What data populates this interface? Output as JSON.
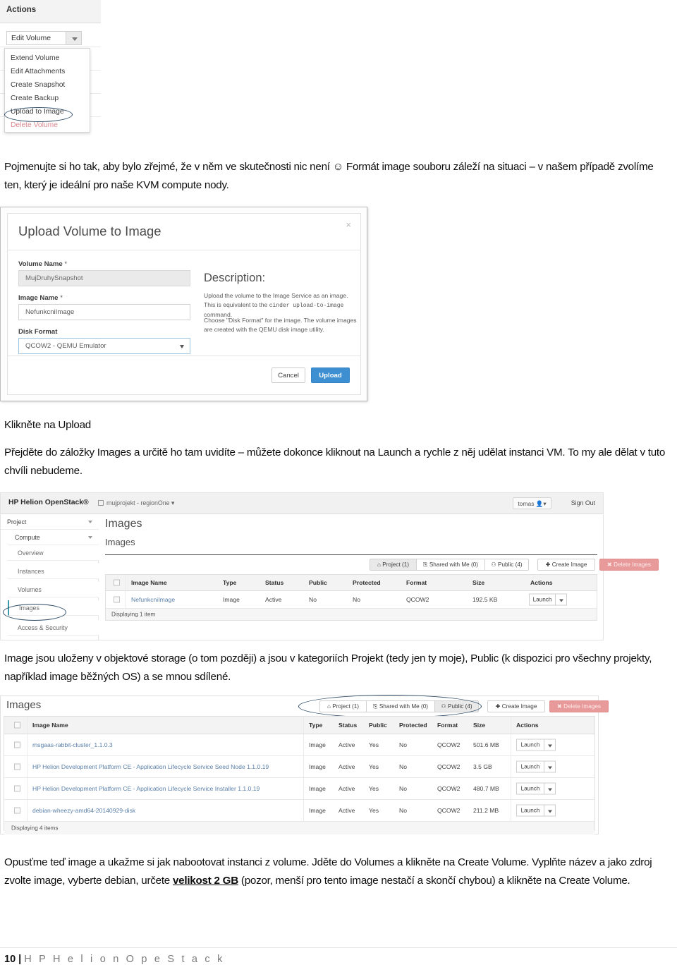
{
  "page": {
    "footer_page_number": "10",
    "footer_separator": "|",
    "footer_title": "H P   H e l i o n   O p e S t a c k"
  },
  "shot_actions": {
    "panel_title": "Actions",
    "edit_button": "Edit Volume",
    "menu_items": [
      "Extend Volume",
      "Edit Attachments",
      "Create Snapshot",
      "Create Backup",
      "Upload to Image",
      "Delete Volume"
    ],
    "highlighted_item": "Upload to Image"
  },
  "paragraph_1": "Pojmenujte si ho tak, aby bylo zřejmé, že v něm ve skutečnosti nic není ☺ Formát image souboru záleží na situaci – v našem případě zvolíme ten, který je ideální pro naše KVM compute nody.",
  "shot_upload": {
    "title": "Upload Volume to Image",
    "close_icon": "×",
    "volume_name_label": "Volume Name",
    "required_mark": "*",
    "volume_name_value": "MujDruhySnapshot",
    "image_name_label": "Image Name",
    "image_name_value": "NefunkcniImage",
    "disk_format_label": "Disk Format",
    "disk_format_value": "QCOW2 - QEMU Emulator",
    "description_heading": "Description:",
    "description_p1_a": "Upload the volume to the Image Service as an image. This is equivalent to the ",
    "description_p1_code": "cinder upload-to-image",
    "description_p1_b": " command.",
    "description_p2": "Choose \"Disk Format\" for the image. The volume images are created with the QEMU disk image utility.",
    "cancel_button": "Cancel",
    "upload_button": "Upload"
  },
  "paragraph_2": "Klikněte na Upload",
  "paragraph_3": "Přejděte do záložky Images a určitě ho tam uvidíte – můžete dokonce kliknout na Launch a rychle z něj udělat instanci VM. To my ale dělat v tuto chvíli nebudeme.",
  "shot_dashboard": {
    "brand": "HP Helion OpenStack®",
    "project_selector": "mujprojekt - regionOne",
    "user_menu": "tomas",
    "sign_out": "Sign Out",
    "sidebar": [
      {
        "label": "Project",
        "level": 0,
        "caret": true,
        "active": false
      },
      {
        "label": "Compute",
        "level": 1,
        "caret": true,
        "active": false
      },
      {
        "label": "Overview",
        "level": 2,
        "caret": false,
        "active": false
      },
      {
        "label": "Instances",
        "level": 2,
        "caret": false,
        "active": false
      },
      {
        "label": "Volumes",
        "level": 2,
        "caret": false,
        "active": false
      },
      {
        "label": "Images",
        "level": 2,
        "caret": false,
        "active": true
      },
      {
        "label": "Access & Security",
        "level": 2,
        "caret": false,
        "active": false
      }
    ],
    "page_heading": "Images",
    "section_heading": "Images",
    "filters": [
      {
        "label": "Project (1)",
        "icon": "home-icon",
        "active": true
      },
      {
        "label": "Shared with Me (0)",
        "icon": "share-icon",
        "active": false
      },
      {
        "label": "Public (4)",
        "icon": "group-icon",
        "active": false
      }
    ],
    "create_image_button": "Create Image",
    "delete_images_button": "Delete Images",
    "columns": [
      "Image Name",
      "Type",
      "Status",
      "Public",
      "Protected",
      "Format",
      "Size",
      "Actions"
    ],
    "rows": [
      {
        "name": "NefunkcniImage",
        "type": "Image",
        "status": "Active",
        "public": "No",
        "protected": "No",
        "format": "QCOW2",
        "size": "192.5 KB",
        "action": "Launch"
      }
    ],
    "displaying": "Displaying 1 item"
  },
  "paragraph_4": "Image jsou uloženy v objektové storage (o tom později) a jsou v kategoriích Projekt (tedy jen ty moje), Public (k dispozici pro všechny projekty, například image běžných OS) a se mnou sdílené.",
  "shot_public": {
    "section_heading": "Images",
    "filters": [
      {
        "label": "Project (1)",
        "icon": "home-icon",
        "active": false
      },
      {
        "label": "Shared with Me (0)",
        "icon": "share-icon",
        "active": false
      },
      {
        "label": "Public (4)",
        "icon": "group-icon",
        "active": true
      }
    ],
    "create_image_button": "Create Image",
    "delete_images_button": "Delete Images",
    "columns": [
      "Image Name",
      "Type",
      "Status",
      "Public",
      "Protected",
      "Format",
      "Size",
      "Actions"
    ],
    "rows": [
      {
        "name": "msgaas-rabbit-cluster_1.1.0.3",
        "type": "Image",
        "status": "Active",
        "public": "Yes",
        "protected": "No",
        "format": "QCOW2",
        "size": "501.6 MB",
        "action": "Launch"
      },
      {
        "name": "HP Helion Development Platform CE - Application Lifecycle Service Seed Node 1.1.0.19",
        "type": "Image",
        "status": "Active",
        "public": "Yes",
        "protected": "No",
        "format": "QCOW2",
        "size": "3.5 GB",
        "action": "Launch"
      },
      {
        "name": "HP Helion Development Platform CE - Application Lifecycle Service Installer 1.1.0.19",
        "type": "Image",
        "status": "Active",
        "public": "Yes",
        "protected": "No",
        "format": "QCOW2",
        "size": "480.7 MB",
        "action": "Launch"
      },
      {
        "name": "debian-wheezy-amd64-20140929-disk",
        "type": "Image",
        "status": "Active",
        "public": "Yes",
        "protected": "No",
        "format": "QCOW2",
        "size": "211.2 MB",
        "action": "Launch"
      }
    ],
    "displaying": "Displaying 4 items"
  },
  "paragraph_5_a": "Opusťme teď image a ukažme si jak nabootovat instanci z volume. Jděte do Volumes a klikněte na Create Volume. Vyplňte název a jako zdroj zvolte image, vyberte debian, určete ",
  "paragraph_5_bold": "velikost 2 GB",
  "paragraph_5_b": " (pozor, menší pro tento image nestačí a skončí chybou) a klikněte na Create Volume.",
  "colors": {
    "accent_blue": "#3d8fd1",
    "danger_red": "#e89a9a",
    "annotation_navy": "#2b4a66",
    "link_blue": "#5a7fa8",
    "active_teal": "#3b9aa8"
  }
}
